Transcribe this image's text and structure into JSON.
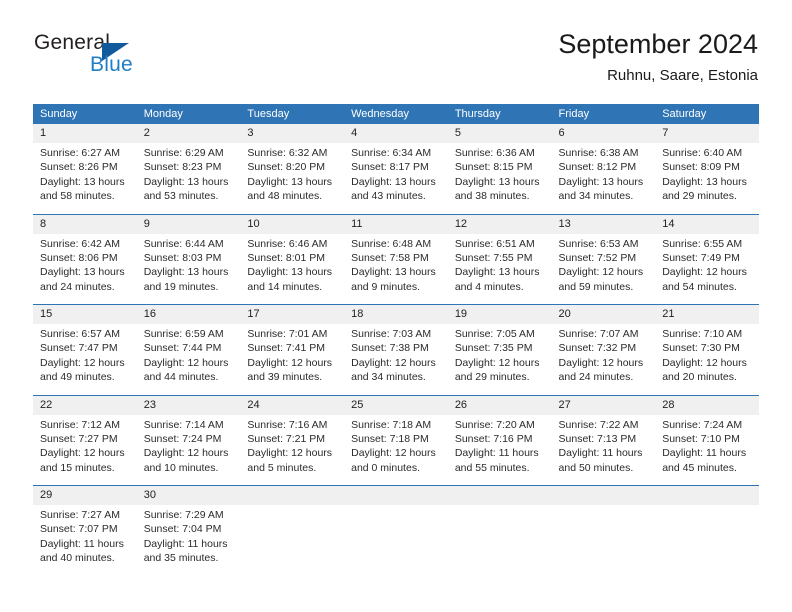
{
  "brand": {
    "name_top": "General",
    "name_bottom": "Blue",
    "accent_color": "#1f7ec4",
    "triangle_color": "#125a9c"
  },
  "header": {
    "title": "September 2024",
    "subtitle": "Ruhnu, Saare, Estonia"
  },
  "theme": {
    "header_blue": "#2f74b5",
    "daynum_band": "#f0f0f0",
    "text": "#2b2b2b"
  },
  "weekdays": [
    "Sunday",
    "Monday",
    "Tuesday",
    "Wednesday",
    "Thursday",
    "Friday",
    "Saturday"
  ],
  "weeks": [
    [
      {
        "day": "1",
        "sunrise": "Sunrise: 6:27 AM",
        "sunset": "Sunset: 8:26 PM",
        "daylight1": "Daylight: 13 hours",
        "daylight2": "and 58 minutes."
      },
      {
        "day": "2",
        "sunrise": "Sunrise: 6:29 AM",
        "sunset": "Sunset: 8:23 PM",
        "daylight1": "Daylight: 13 hours",
        "daylight2": "and 53 minutes."
      },
      {
        "day": "3",
        "sunrise": "Sunrise: 6:32 AM",
        "sunset": "Sunset: 8:20 PM",
        "daylight1": "Daylight: 13 hours",
        "daylight2": "and 48 minutes."
      },
      {
        "day": "4",
        "sunrise": "Sunrise: 6:34 AM",
        "sunset": "Sunset: 8:17 PM",
        "daylight1": "Daylight: 13 hours",
        "daylight2": "and 43 minutes."
      },
      {
        "day": "5",
        "sunrise": "Sunrise: 6:36 AM",
        "sunset": "Sunset: 8:15 PM",
        "daylight1": "Daylight: 13 hours",
        "daylight2": "and 38 minutes."
      },
      {
        "day": "6",
        "sunrise": "Sunrise: 6:38 AM",
        "sunset": "Sunset: 8:12 PM",
        "daylight1": "Daylight: 13 hours",
        "daylight2": "and 34 minutes."
      },
      {
        "day": "7",
        "sunrise": "Sunrise: 6:40 AM",
        "sunset": "Sunset: 8:09 PM",
        "daylight1": "Daylight: 13 hours",
        "daylight2": "and 29 minutes."
      }
    ],
    [
      {
        "day": "8",
        "sunrise": "Sunrise: 6:42 AM",
        "sunset": "Sunset: 8:06 PM",
        "daylight1": "Daylight: 13 hours",
        "daylight2": "and 24 minutes."
      },
      {
        "day": "9",
        "sunrise": "Sunrise: 6:44 AM",
        "sunset": "Sunset: 8:03 PM",
        "daylight1": "Daylight: 13 hours",
        "daylight2": "and 19 minutes."
      },
      {
        "day": "10",
        "sunrise": "Sunrise: 6:46 AM",
        "sunset": "Sunset: 8:01 PM",
        "daylight1": "Daylight: 13 hours",
        "daylight2": "and 14 minutes."
      },
      {
        "day": "11",
        "sunrise": "Sunrise: 6:48 AM",
        "sunset": "Sunset: 7:58 PM",
        "daylight1": "Daylight: 13 hours",
        "daylight2": "and 9 minutes."
      },
      {
        "day": "12",
        "sunrise": "Sunrise: 6:51 AM",
        "sunset": "Sunset: 7:55 PM",
        "daylight1": "Daylight: 13 hours",
        "daylight2": "and 4 minutes."
      },
      {
        "day": "13",
        "sunrise": "Sunrise: 6:53 AM",
        "sunset": "Sunset: 7:52 PM",
        "daylight1": "Daylight: 12 hours",
        "daylight2": "and 59 minutes."
      },
      {
        "day": "14",
        "sunrise": "Sunrise: 6:55 AM",
        "sunset": "Sunset: 7:49 PM",
        "daylight1": "Daylight: 12 hours",
        "daylight2": "and 54 minutes."
      }
    ],
    [
      {
        "day": "15",
        "sunrise": "Sunrise: 6:57 AM",
        "sunset": "Sunset: 7:47 PM",
        "daylight1": "Daylight: 12 hours",
        "daylight2": "and 49 minutes."
      },
      {
        "day": "16",
        "sunrise": "Sunrise: 6:59 AM",
        "sunset": "Sunset: 7:44 PM",
        "daylight1": "Daylight: 12 hours",
        "daylight2": "and 44 minutes."
      },
      {
        "day": "17",
        "sunrise": "Sunrise: 7:01 AM",
        "sunset": "Sunset: 7:41 PM",
        "daylight1": "Daylight: 12 hours",
        "daylight2": "and 39 minutes."
      },
      {
        "day": "18",
        "sunrise": "Sunrise: 7:03 AM",
        "sunset": "Sunset: 7:38 PM",
        "daylight1": "Daylight: 12 hours",
        "daylight2": "and 34 minutes."
      },
      {
        "day": "19",
        "sunrise": "Sunrise: 7:05 AM",
        "sunset": "Sunset: 7:35 PM",
        "daylight1": "Daylight: 12 hours",
        "daylight2": "and 29 minutes."
      },
      {
        "day": "20",
        "sunrise": "Sunrise: 7:07 AM",
        "sunset": "Sunset: 7:32 PM",
        "daylight1": "Daylight: 12 hours",
        "daylight2": "and 24 minutes."
      },
      {
        "day": "21",
        "sunrise": "Sunrise: 7:10 AM",
        "sunset": "Sunset: 7:30 PM",
        "daylight1": "Daylight: 12 hours",
        "daylight2": "and 20 minutes."
      }
    ],
    [
      {
        "day": "22",
        "sunrise": "Sunrise: 7:12 AM",
        "sunset": "Sunset: 7:27 PM",
        "daylight1": "Daylight: 12 hours",
        "daylight2": "and 15 minutes."
      },
      {
        "day": "23",
        "sunrise": "Sunrise: 7:14 AM",
        "sunset": "Sunset: 7:24 PM",
        "daylight1": "Daylight: 12 hours",
        "daylight2": "and 10 minutes."
      },
      {
        "day": "24",
        "sunrise": "Sunrise: 7:16 AM",
        "sunset": "Sunset: 7:21 PM",
        "daylight1": "Daylight: 12 hours",
        "daylight2": "and 5 minutes."
      },
      {
        "day": "25",
        "sunrise": "Sunrise: 7:18 AM",
        "sunset": "Sunset: 7:18 PM",
        "daylight1": "Daylight: 12 hours",
        "daylight2": "and 0 minutes."
      },
      {
        "day": "26",
        "sunrise": "Sunrise: 7:20 AM",
        "sunset": "Sunset: 7:16 PM",
        "daylight1": "Daylight: 11 hours",
        "daylight2": "and 55 minutes."
      },
      {
        "day": "27",
        "sunrise": "Sunrise: 7:22 AM",
        "sunset": "Sunset: 7:13 PM",
        "daylight1": "Daylight: 11 hours",
        "daylight2": "and 50 minutes."
      },
      {
        "day": "28",
        "sunrise": "Sunrise: 7:24 AM",
        "sunset": "Sunset: 7:10 PM",
        "daylight1": "Daylight: 11 hours",
        "daylight2": "and 45 minutes."
      }
    ],
    [
      {
        "day": "29",
        "sunrise": "Sunrise: 7:27 AM",
        "sunset": "Sunset: 7:07 PM",
        "daylight1": "Daylight: 11 hours",
        "daylight2": "and 40 minutes."
      },
      {
        "day": "30",
        "sunrise": "Sunrise: 7:29 AM",
        "sunset": "Sunset: 7:04 PM",
        "daylight1": "Daylight: 11 hours",
        "daylight2": "and 35 minutes."
      },
      {
        "day": "",
        "sunrise": "",
        "sunset": "",
        "daylight1": "",
        "daylight2": ""
      },
      {
        "day": "",
        "sunrise": "",
        "sunset": "",
        "daylight1": "",
        "daylight2": ""
      },
      {
        "day": "",
        "sunrise": "",
        "sunset": "",
        "daylight1": "",
        "daylight2": ""
      },
      {
        "day": "",
        "sunrise": "",
        "sunset": "",
        "daylight1": "",
        "daylight2": ""
      },
      {
        "day": "",
        "sunrise": "",
        "sunset": "",
        "daylight1": "",
        "daylight2": ""
      }
    ]
  ]
}
